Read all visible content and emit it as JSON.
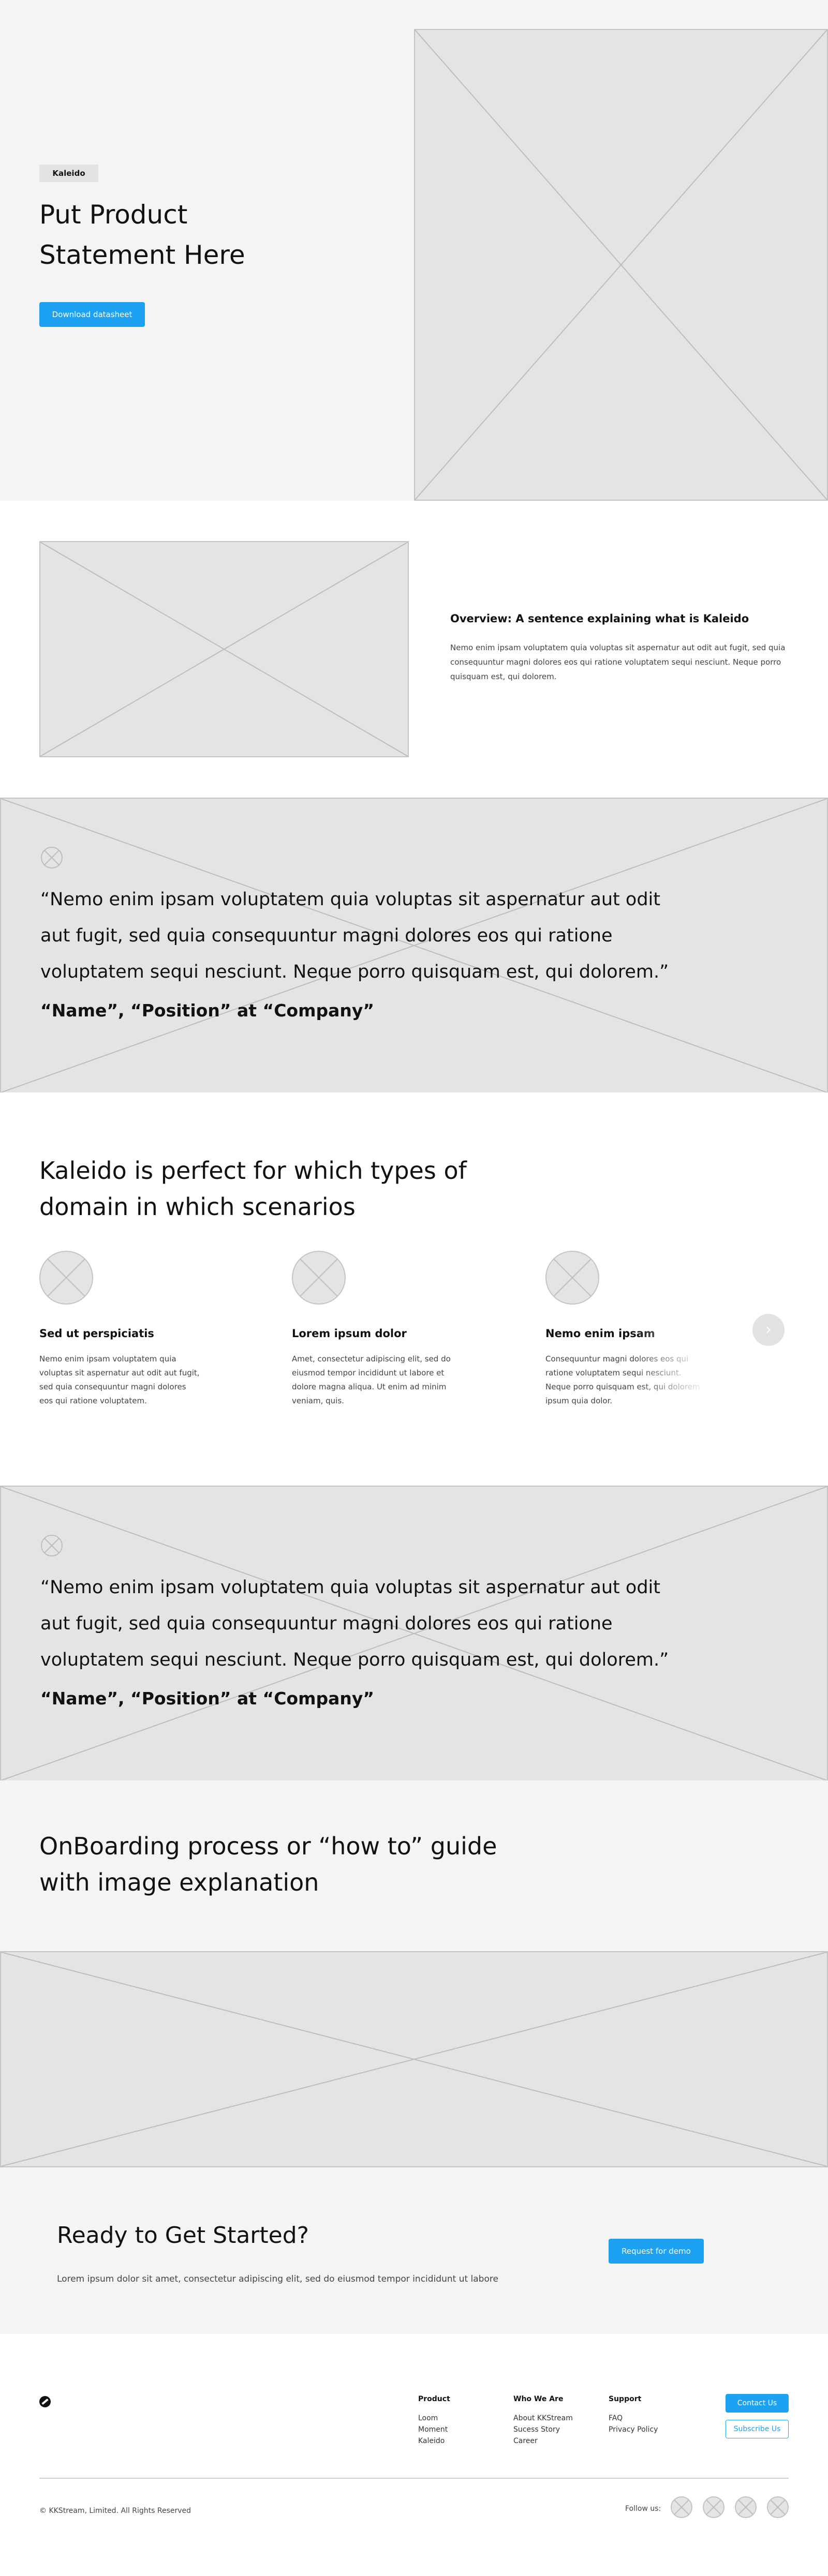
{
  "hero": {
    "tag": "Kaleido",
    "title": "Put Product Statement Here",
    "button": "Download datasheet"
  },
  "overview": {
    "title": "Overview: A sentence explaining what is Kaleido",
    "text": "Nemo enim ipsam voluptatem quia voluptas sit aspernatur aut odit aut fugit, sed quia consequuntur magni dolores eos qui ratione voluptatem sequi nesciunt. Neque porro quisquam est, qui dolorem."
  },
  "testimonial1": {
    "quote": "“Nemo enim ipsam voluptatem quia voluptas sit aspernatur aut odit aut fugit, sed quia consequuntur magni dolores eos qui ratione voluptatem sequi nesciunt. Neque porro quisquam est, qui dolorem.”",
    "author": "“Name”, “Position” at “Company”"
  },
  "domains": {
    "title": "Kaleido is perfect for which types of domain in which scenarios",
    "items": [
      {
        "title": "Sed ut perspiciatis",
        "text": "Nemo enim ipsam voluptatem quia voluptas sit aspernatur aut odit aut fugit, sed quia consequuntur magni dolores eos qui ratione voluptatem."
      },
      {
        "title": "Lorem ipsum dolor",
        "text": "Amet, consectetur adipiscing elit, sed do eiusmod tempor incididunt ut labore et dolore magna aliqua. Ut enim ad minim veniam, quis."
      },
      {
        "title": "Nemo enim ipsam",
        "text": "Consequuntur magni dolores eos qui ratione voluptatem sequi nesciunt. Neque porro quisquam est, qui dolorem ipsum quia dolor."
      }
    ],
    "next": "›"
  },
  "testimonial2": {
    "quote": "“Nemo enim ipsam voluptatem quia voluptas sit aspernatur aut odit aut fugit, sed quia consequuntur magni dolores eos qui ratione voluptatem sequi nesciunt. Neque porro quisquam est, qui dolorem.”",
    "author": "“Name”, “Position” at “Company”"
  },
  "onboarding": {
    "title": "OnBoarding process or “how to” guide with image explanation"
  },
  "cta": {
    "title": "Ready to Get Started?",
    "text": "Lorem ipsum dolor sit amet, consectetur adipiscing elit, sed do eiusmod tempor incididunt ut labore",
    "button": "Request for demo"
  },
  "footer": {
    "columns": [
      {
        "heading": "Product",
        "items": [
          "Loom",
          "Moment",
          "Kaleido"
        ]
      },
      {
        "heading": "Who We Are",
        "items": [
          "About KKStream",
          "Sucess Story",
          "Career"
        ]
      },
      {
        "heading": "Support",
        "items": [
          "FAQ",
          "Privacy Policy"
        ]
      }
    ],
    "contact_button": "Contact Us",
    "subscribe_button": "Subscribe Us",
    "copyright": "© KKStream, Limited. All Rights Reserved",
    "follow": "Follow us:"
  },
  "colors": {
    "accent": "#1da1f2",
    "placeholder": "#e4e4e4",
    "section_bg": "#f4f4f4"
  },
  "icons": [
    "image-placeholder",
    "quote-icon",
    "chevron-right-icon",
    "logo-icon",
    "social-icon"
  ]
}
